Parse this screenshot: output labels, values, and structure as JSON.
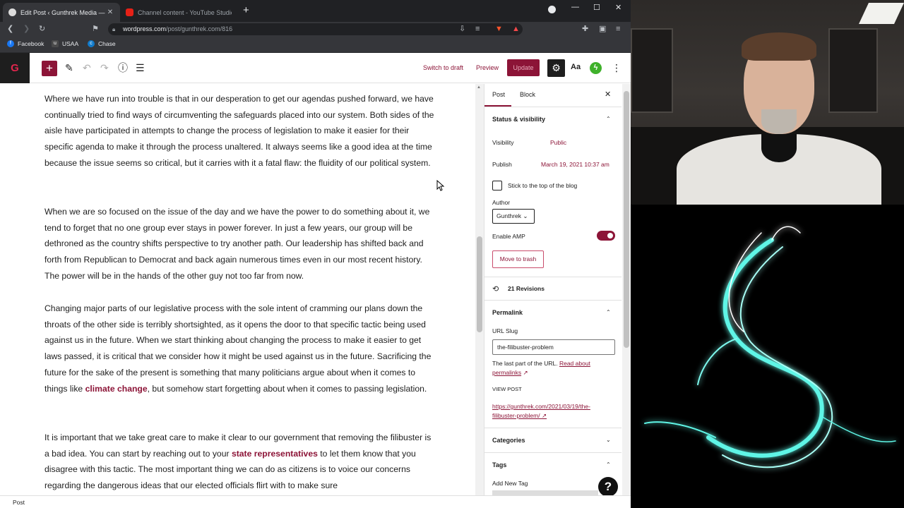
{
  "browser": {
    "tabs": [
      {
        "title": "Edit Post ‹ Gunthrek Media — W",
        "active": true
      },
      {
        "title": "Channel content - YouTube Studio",
        "active": false
      }
    ],
    "new_tab": "+",
    "url": {
      "host": "wordpress.com",
      "path": "/post/gunthrek.com/816"
    },
    "bookmarks": [
      {
        "label": "Facebook",
        "color": "#1877f2"
      },
      {
        "label": "USAA",
        "color": "#4a4a4a"
      },
      {
        "label": "Chase",
        "color": "#117aca"
      }
    ]
  },
  "wp_header": {
    "logo": "G",
    "switch_to_draft": "Switch to draft",
    "preview": "Preview",
    "update": "Update",
    "aa": "Aa"
  },
  "content": {
    "paragraphs": [
      {
        "text": "Where we have run into trouble is that in our desperation to get our agendas pushed forward, we have continually tried to find ways of circumventing the safeguards placed into our system.  Both sides of the aisle have participated in attempts to change the process of legislation to make it easier for their specific agenda to make it through the process unaltered.  It always seems like a good idea at the time because the issue seems so critical, but it carries with it a fatal flaw:  the fluidity of our political system."
      },
      {
        "text": "When we are so focused on the issue of the day and we have the power to do something about it, we tend to forget that no one group ever stays in power forever.  In just a few years, our group will be dethroned as the country shifts perspective to try another path.  Our leadership has shifted back and forth from Republican to Democrat and back again numerous times even in our most recent history.  The power will be in the hands of the other guy not too far from now."
      },
      {
        "before": "Changing major parts of our legislative process with the sole intent of cramming our plans down the throats of the other side is terribly shortsighted, as it opens the door to that specific tactic being used against us in the future.  When we start thinking about changing the process to make it easier to get laws passed, it is critical that we consider how it might be used against us in the future.  Sacrificing the future for the sake of the present is something that many politicians argue about when it comes to things like ",
        "link": "climate change",
        "after": ", but somehow start forgetting about when it comes to passing legislation."
      },
      {
        "before": "It is important that we take great care to make it clear to our government that removing the filibuster is a bad idea.  You can start by reaching out to your ",
        "link": "state representatives",
        "after": " to let them know that you disagree with this tactic.  The most important thing we can do as citizens is to voice our concerns regarding the dangerous ideas that our elected officials flirt with to make sure"
      }
    ]
  },
  "sidebar": {
    "tabs": [
      "Post",
      "Block"
    ],
    "close": "✕",
    "status_heading": "Status & visibility",
    "visibility_label": "Visibility",
    "visibility_value": "Public",
    "publish_label": "Publish",
    "publish_value": "March 19, 2021 10:37 am",
    "sticky_label": "Stick to the top of the blog",
    "author_label": "Author",
    "author_value": "Gunthrek",
    "amp_label": "Enable AMP",
    "amp_enabled": true,
    "trash_button": "Move to trash",
    "revisions": "21 Revisions",
    "permalink_heading": "Permalink",
    "url_slug_label": "URL Slug",
    "url_slug_value": "the-filibuster-problem",
    "help_text": "The last part of the URL. ",
    "help_link": "Read about permalinks",
    "view_post_label": "VIEW POST",
    "view_post_url": "https://gunthrek.com/2021/03/19/the-filibuster-problem/",
    "categories_heading": "Categories",
    "tags_heading": "Tags",
    "add_tag_label": "Add New Tag"
  },
  "statusbar": {
    "breadcrumb": "Post"
  },
  "help_button": "?",
  "colors": {
    "accent": "#8c1437",
    "amp_toggle": "#8c1437",
    "art_glow": "#5ff5e6"
  }
}
